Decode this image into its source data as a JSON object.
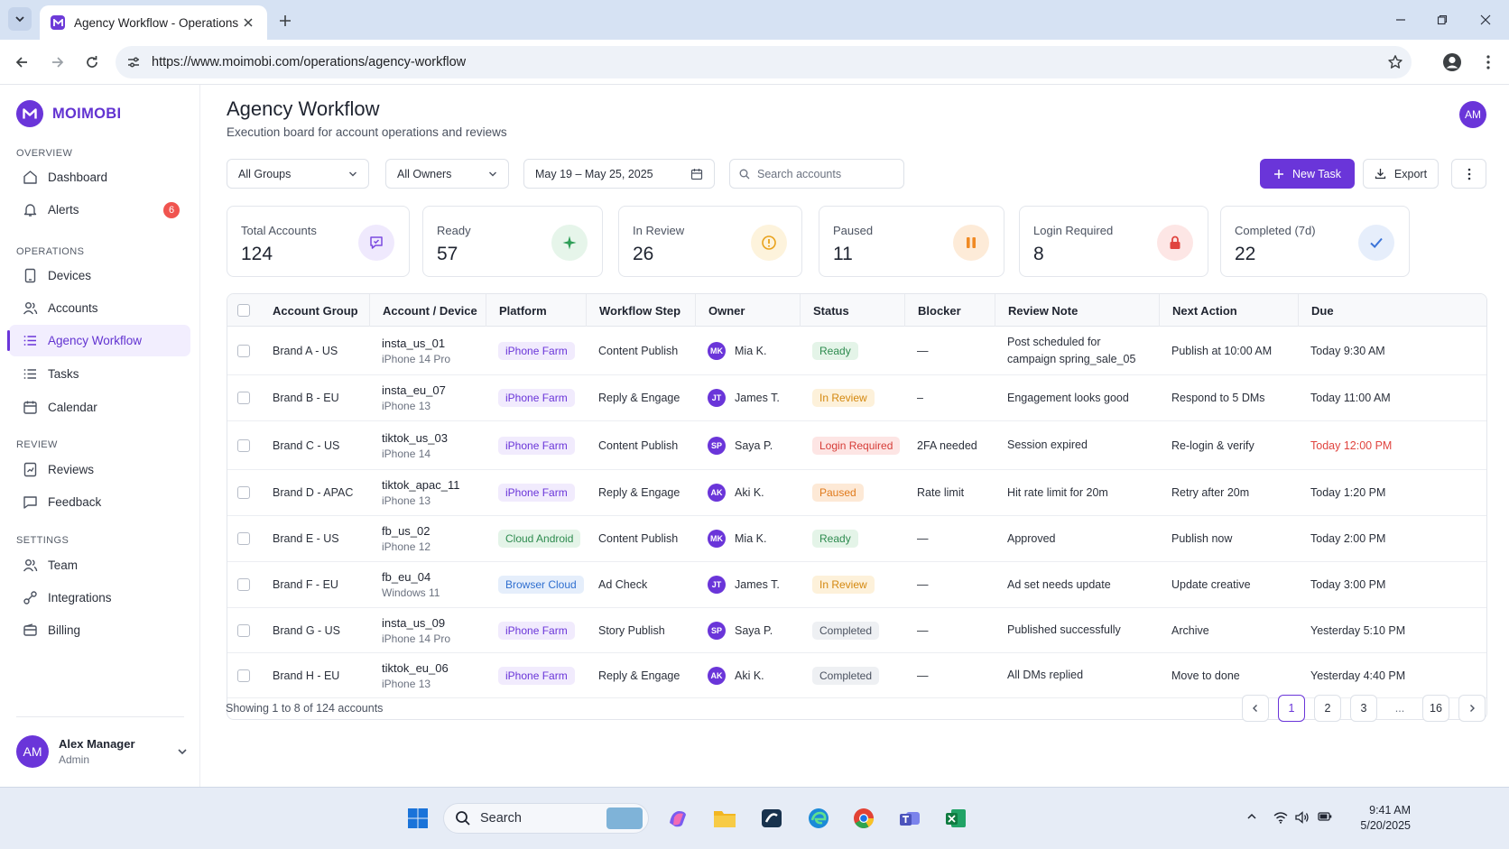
{
  "browser": {
    "tab_title": "Agency Workflow - Operations",
    "url": "https://www.moimobi.com/operations/agency-workflow"
  },
  "sidebar": {
    "brand": "MOIMOBI",
    "sections": {
      "overview": "OVERVIEW",
      "operations": "OPERATIONS",
      "review": "REVIEW",
      "settings": "SETTINGS"
    },
    "items": [
      {
        "label": "Dashboard",
        "icon": "home-icon"
      },
      {
        "label": "Alerts",
        "icon": "bell-icon",
        "badge": "6"
      },
      {
        "label": "Devices",
        "icon": "tablet-icon"
      },
      {
        "label": "Accounts",
        "icon": "users-icon"
      },
      {
        "label": "Agency Workflow",
        "icon": "list-icon",
        "active": true
      },
      {
        "label": "Tasks",
        "icon": "list-icon"
      },
      {
        "label": "Calendar",
        "icon": "calendar-icon"
      },
      {
        "label": "Reviews",
        "icon": "review-icon"
      },
      {
        "label": "Feedback",
        "icon": "message-icon"
      },
      {
        "label": "Team",
        "icon": "users-icon"
      },
      {
        "label": "Integrations",
        "icon": "link-icon"
      },
      {
        "label": "Billing",
        "icon": "wallet-icon"
      }
    ],
    "user": {
      "initials": "AM",
      "name": "Alex Manager",
      "role": "Admin"
    }
  },
  "header": {
    "title": "Agency Workflow",
    "subtitle": "Execution board for account operations and reviews",
    "avatar_initials": "AM"
  },
  "filters": {
    "groups": "All Groups",
    "owners": "All Owners",
    "date_range": "May 19 – May 25, 2025",
    "search_placeholder": "Search accounts",
    "new_task": "New Task",
    "export": "Export"
  },
  "kpis": [
    {
      "label": "Total Accounts",
      "value": "124",
      "icon": "message-check-icon",
      "color": "#7b4ae0",
      "bg": "#efe9fd"
    },
    {
      "label": "Ready",
      "value": "57",
      "icon": "sparkle-icon",
      "color": "#2e9e57",
      "bg": "#e6f5ea"
    },
    {
      "label": "In Review",
      "value": "26",
      "icon": "info-circle-icon",
      "color": "#e9a21b",
      "bg": "#fdf3dc"
    },
    {
      "label": "Paused",
      "value": "11",
      "icon": "pause-icon",
      "color": "#f08a24",
      "bg": "#fdebd8"
    },
    {
      "label": "Login Required",
      "value": "8",
      "icon": "lock-icon",
      "color": "#e0443f",
      "bg": "#fde6e5"
    },
    {
      "label": "Completed (7d)",
      "value": "22",
      "icon": "check-icon",
      "color": "#3b74d8",
      "bg": "#e6eefb"
    }
  ],
  "table": {
    "headers": [
      "Account Group",
      "Account / Device",
      "Platform",
      "Workflow Step",
      "Owner",
      "Status",
      "Blocker",
      "Review Note",
      "Next Action",
      "Due"
    ],
    "rows": [
      {
        "group": "Brand A - US",
        "account": "insta_us_01",
        "device": "iPhone 14 Pro",
        "platform": "iPhone Farm",
        "step": "Content Publish",
        "owner_initials": "MK",
        "owner": "Mia K.",
        "status": "Ready",
        "blocker": "—",
        "note": "Post scheduled for campaign spring_sale_05",
        "next": "Publish at 10:00 AM",
        "due": "Today 9:30 AM",
        "due_alert": false
      },
      {
        "group": "Brand B - EU",
        "account": "insta_eu_07",
        "device": "iPhone 13",
        "platform": "iPhone Farm",
        "step": "Reply & Engage",
        "owner_initials": "JT",
        "owner": "James T.",
        "status": "In Review",
        "blocker": "–",
        "note": "Engagement looks good",
        "next": "Respond to 5 DMs",
        "due": "Today 11:00 AM",
        "due_alert": false
      },
      {
        "group": "Brand C - US",
        "account": "tiktok_us_03",
        "device": "iPhone 14",
        "platform": "iPhone Farm",
        "step": "Content Publish",
        "owner_initials": "SP",
        "owner": "Saya P.",
        "status": "Login Required",
        "blocker": "2FA needed",
        "note": "Session expired",
        "next": "Re-login & verify",
        "due": "Today 12:00 PM",
        "due_alert": true
      },
      {
        "group": "Brand D - APAC",
        "account": "tiktok_apac_11",
        "device": "iPhone 13",
        "platform": "iPhone Farm",
        "step": "Reply & Engage",
        "owner_initials": "AK",
        "owner": "Aki K.",
        "status": "Paused",
        "blocker": "Rate limit",
        "note": "Hit rate limit for 20m",
        "next": "Retry after 20m",
        "due": "Today 1:20 PM",
        "due_alert": false
      },
      {
        "group": "Brand E - US",
        "account": "fb_us_02",
        "device": "iPhone 12",
        "platform": "Cloud Android",
        "step": "Content Publish",
        "owner_initials": "MK",
        "owner": "Mia K.",
        "status": "Ready",
        "blocker": "—",
        "note": "Approved",
        "next": "Publish now",
        "due": "Today 2:00 PM",
        "due_alert": false
      },
      {
        "group": "Brand F - EU",
        "account": "fb_eu_04",
        "device": "Windows 11",
        "platform": "Browser Cloud",
        "step": "Ad Check",
        "owner_initials": "JT",
        "owner": "James T.",
        "status": "In Review",
        "blocker": "—",
        "note": "Ad set needs update",
        "next": "Update creative",
        "due": "Today 3:00 PM",
        "due_alert": false
      },
      {
        "group": "Brand G - US",
        "account": "insta_us_09",
        "device": "iPhone 14 Pro",
        "platform": "iPhone Farm",
        "step": "Story Publish",
        "owner_initials": "SP",
        "owner": "Saya P.",
        "status": "Completed",
        "blocker": "—",
        "note": "Published successfully",
        "next": "Archive",
        "due": "Yesterday 5:10 PM",
        "due_alert": false
      },
      {
        "group": "Brand H - EU",
        "account": "tiktok_eu_06",
        "device": "iPhone 13",
        "platform": "iPhone Farm",
        "step": "Reply & Engage",
        "owner_initials": "AK",
        "owner": "Aki K.",
        "status": "Completed",
        "blocker": "—",
        "note": "All DMs replied",
        "next": "Move to done",
        "due": "Yesterday 4:40 PM",
        "due_alert": false
      }
    ]
  },
  "status_colors": {
    "Ready": {
      "fg": "#2e8b4f",
      "bg": "#e4f4e8"
    },
    "In Review": {
      "fg": "#d4880f",
      "bg": "#fdf1da"
    },
    "Login Required": {
      "fg": "#d63c37",
      "bg": "#fde5e4"
    },
    "Paused": {
      "fg": "#e07a1c",
      "bg": "#fde9d6"
    },
    "Completed": {
      "fg": "#4b5260",
      "bg": "#eef0f3"
    }
  },
  "platform_colors": {
    "iPhone Farm": {
      "fg": "#6a35d9",
      "bg": "#f1ebfd"
    },
    "Cloud Android": {
      "fg": "#2e8b4f",
      "bg": "#e4f4e8"
    },
    "Browser Cloud": {
      "fg": "#2f6fd0",
      "bg": "#e5eefb"
    }
  },
  "pagination": {
    "summary": "Showing 1 to 8 of 124 accounts",
    "pages": [
      "1",
      "2",
      "3",
      "...",
      "16"
    ],
    "current": "1"
  },
  "taskbar": {
    "search": "Search",
    "time": "9:41 AM",
    "date": "5/20/2025"
  }
}
